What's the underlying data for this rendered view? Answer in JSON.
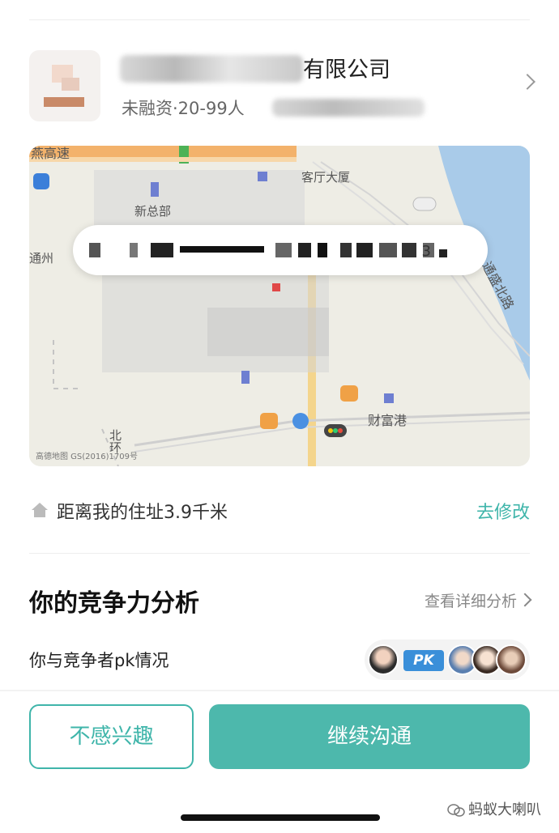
{
  "company": {
    "name": "有限公司",
    "meta": "未融资·20-99人"
  },
  "map": {
    "road_top": "燕高速",
    "label_building": "客厅大厦",
    "label_new": "新总部",
    "label_west": "通州",
    "label_road_right": "通盛北路",
    "label_port": "财富港",
    "label_north": "北环",
    "addr_tail": "3",
    "watermark": "高德地图  GS(2016)1709号"
  },
  "distance": {
    "text": "距离我的住址3.9千米",
    "edit_label": "去修改"
  },
  "competition": {
    "title": "你的竞争力分析",
    "detail_label": "查看详细分析",
    "pk_label": "你与竞争者pk情况",
    "pk_badge": "PK"
  },
  "actions": {
    "not_interested": "不感兴趣",
    "continue": "继续沟通"
  },
  "watermark_text": "蚂蚁大喇叭",
  "colors": {
    "accent": "#3fb5aa",
    "button_fill": "#4db8ac",
    "pk_blue": "#3a8fd9"
  }
}
